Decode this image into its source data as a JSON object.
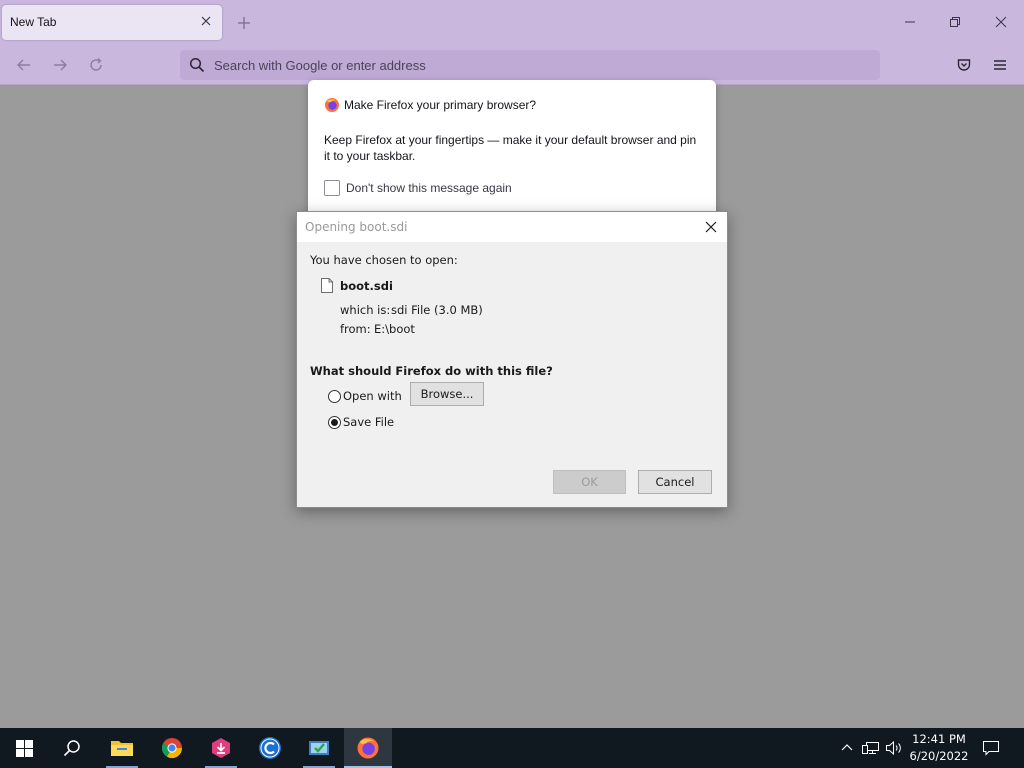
{
  "browser": {
    "tab_title": "New Tab",
    "url_placeholder": "Search with Google or enter address"
  },
  "ff_prompt": {
    "title": "Make Firefox your primary browser?",
    "body": "Keep Firefox at your fingertips — make it your default browser and pin it to your taskbar.",
    "checkbox_label": "Don't show this message again"
  },
  "dialog": {
    "title": "Opening boot.sdi",
    "chosen_label": "You have chosen to open:",
    "file_name": "boot.sdi",
    "which_is_label": "which is:",
    "which_is_value": "sdi File (3.0 MB)",
    "from_label": "from:",
    "from_value": "E:\\boot",
    "question": "What should Firefox do with this file?",
    "open_with_label": "Open with",
    "browse_label": "Browse...",
    "save_file_label": "Save File",
    "ok_label": "OK",
    "cancel_label": "Cancel",
    "selected_action": "Save File"
  },
  "taskbar": {
    "time": "12:41 PM",
    "date": "6/20/2022"
  },
  "colors": {
    "chrome": "#c9b7de",
    "content_overlay": "#9b9b9b",
    "taskbar": "#101820",
    "accent": "#0078d7"
  }
}
